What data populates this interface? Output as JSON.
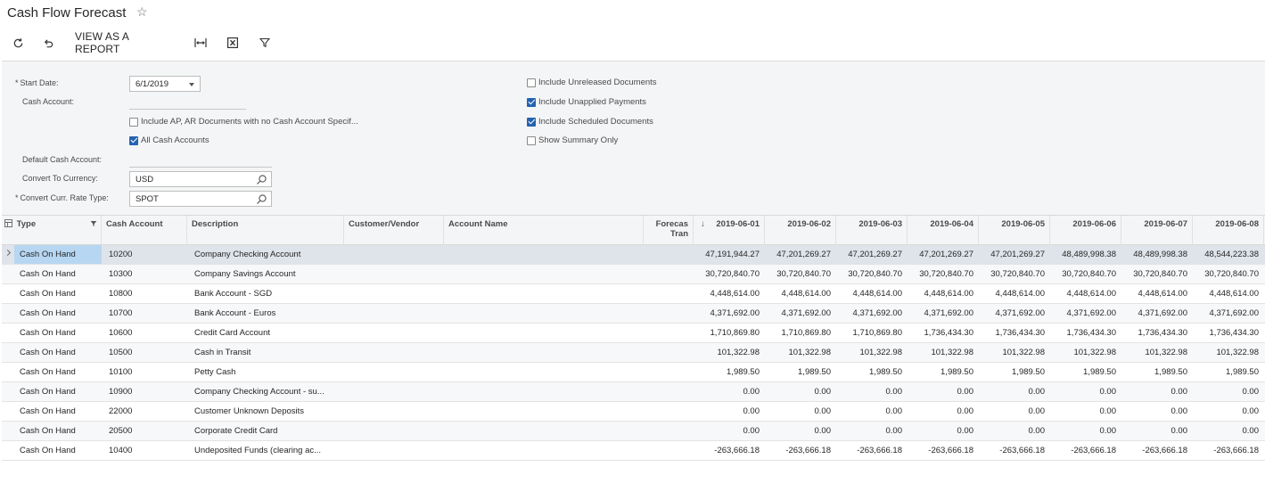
{
  "header": {
    "title": "Cash Flow Forecast",
    "star_icon": "star-outline-icon"
  },
  "toolbar": {
    "refresh_icon": "refresh-icon",
    "undo_icon": "undo-icon",
    "view_report_label": "VIEW AS A REPORT",
    "fit_icon": "fit-columns-icon",
    "excel_icon": "export-excel-icon",
    "filter_icon": "filter-icon"
  },
  "form": {
    "start_date_label": "Start Date:",
    "start_date_value": "6/1/2019",
    "cash_account_label": "Cash Account:",
    "cash_account_value": "",
    "include_ap_ar_label": "Include AP, AR Documents with no Cash Account Specif...",
    "include_ap_ar_checked": false,
    "all_cash_accounts_label": "All Cash Accounts",
    "all_cash_accounts_checked": true,
    "default_cash_account_label": "Default Cash Account:",
    "convert_currency_label": "Convert To Currency:",
    "convert_currency_value": "USD",
    "rate_type_label": "Convert Curr. Rate Type:",
    "rate_type_value": "SPOT",
    "include_unreleased_label": "Include Unreleased Documents",
    "include_unreleased_checked": false,
    "include_unapplied_label": "Include Unapplied Payments",
    "include_unapplied_checked": true,
    "include_scheduled_label": "Include Scheduled Documents",
    "include_scheduled_checked": true,
    "show_summary_label": "Show Summary Only",
    "show_summary_checked": false
  },
  "grid": {
    "columns": {
      "type": "Type",
      "cash_account": "Cash Account",
      "description": "Description",
      "customer_vendor": "Customer/Vendor",
      "account_name": "Account Name",
      "forecast_tran_1": "Forecas",
      "forecast_tran_2": "Tran",
      "sort_arrow": "↓",
      "dates": [
        "2019-06-01",
        "2019-06-02",
        "2019-06-03",
        "2019-06-04",
        "2019-06-05",
        "2019-06-06",
        "2019-06-07",
        "2019-06-08"
      ]
    },
    "rows": [
      {
        "type": "Cash On Hand",
        "account": "10200",
        "description": "Company Checking Account",
        "values": [
          "47,191,944.27",
          "47,201,269.27",
          "47,201,269.27",
          "47,201,269.27",
          "47,201,269.27",
          "48,489,998.38",
          "48,489,998.38",
          "48,544,223.38"
        ]
      },
      {
        "type": "Cash On Hand",
        "account": "10300",
        "description": "Company Savings Account",
        "values": [
          "30,720,840.70",
          "30,720,840.70",
          "30,720,840.70",
          "30,720,840.70",
          "30,720,840.70",
          "30,720,840.70",
          "30,720,840.70",
          "30,720,840.70"
        ]
      },
      {
        "type": "Cash On Hand",
        "account": "10800",
        "description": "Bank Account - SGD",
        "values": [
          "4,448,614.00",
          "4,448,614.00",
          "4,448,614.00",
          "4,448,614.00",
          "4,448,614.00",
          "4,448,614.00",
          "4,448,614.00",
          "4,448,614.00"
        ]
      },
      {
        "type": "Cash On Hand",
        "account": "10700",
        "description": "Bank Account - Euros",
        "values": [
          "4,371,692.00",
          "4,371,692.00",
          "4,371,692.00",
          "4,371,692.00",
          "4,371,692.00",
          "4,371,692.00",
          "4,371,692.00",
          "4,371,692.00"
        ]
      },
      {
        "type": "Cash On Hand",
        "account": "10600",
        "description": "Credit Card Account",
        "values": [
          "1,710,869.80",
          "1,710,869.80",
          "1,710,869.80",
          "1,736,434.30",
          "1,736,434.30",
          "1,736,434.30",
          "1,736,434.30",
          "1,736,434.30"
        ]
      },
      {
        "type": "Cash On Hand",
        "account": "10500",
        "description": "Cash in Transit",
        "values": [
          "101,322.98",
          "101,322.98",
          "101,322.98",
          "101,322.98",
          "101,322.98",
          "101,322.98",
          "101,322.98",
          "101,322.98"
        ]
      },
      {
        "type": "Cash On Hand",
        "account": "10100",
        "description": "Petty Cash",
        "values": [
          "1,989.50",
          "1,989.50",
          "1,989.50",
          "1,989.50",
          "1,989.50",
          "1,989.50",
          "1,989.50",
          "1,989.50"
        ]
      },
      {
        "type": "Cash On Hand",
        "account": "10900",
        "description": "Company Checking Account - su...",
        "values": [
          "0.00",
          "0.00",
          "0.00",
          "0.00",
          "0.00",
          "0.00",
          "0.00",
          "0.00"
        ]
      },
      {
        "type": "Cash On Hand",
        "account": "22000",
        "description": "Customer Unknown Deposits",
        "values": [
          "0.00",
          "0.00",
          "0.00",
          "0.00",
          "0.00",
          "0.00",
          "0.00",
          "0.00"
        ]
      },
      {
        "type": "Cash On Hand",
        "account": "20500",
        "description": "Corporate Credit Card",
        "values": [
          "0.00",
          "0.00",
          "0.00",
          "0.00",
          "0.00",
          "0.00",
          "0.00",
          "0.00"
        ]
      },
      {
        "type": "Cash On Hand",
        "account": "10400",
        "description": "Undeposited Funds (clearing ac...",
        "values": [
          "-263,666.18",
          "-263,666.18",
          "-263,666.18",
          "-263,666.18",
          "-263,666.18",
          "-263,666.18",
          "-263,666.18",
          "-263,666.18"
        ]
      }
    ]
  }
}
